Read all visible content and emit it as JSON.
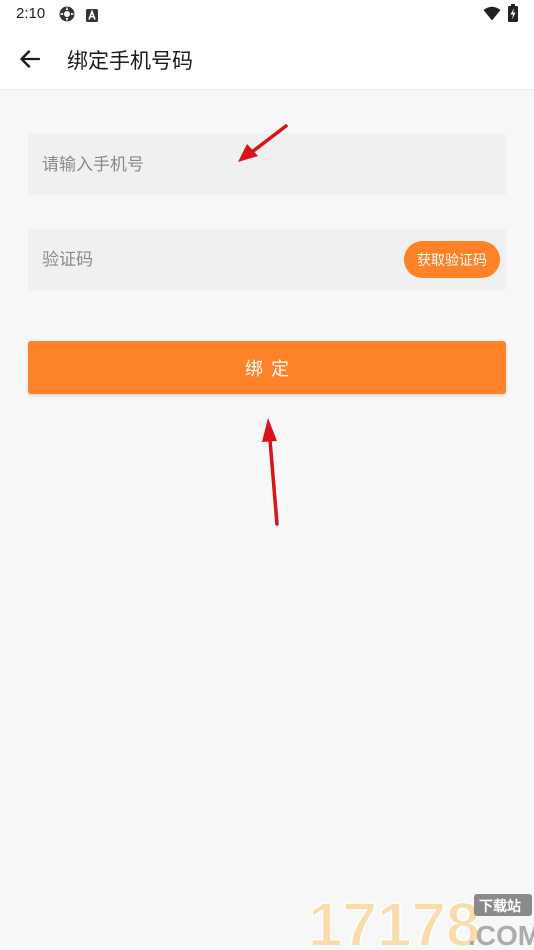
{
  "status_bar": {
    "time": "2:10",
    "icons": [
      "settings-gear-icon",
      "a-badge-icon",
      "wifi-icon",
      "battery-charging-icon"
    ]
  },
  "app_bar": {
    "back_icon": "arrow-left-icon",
    "title": "绑定手机号码"
  },
  "form": {
    "phone": {
      "placeholder": "请输入手机号",
      "value": ""
    },
    "code": {
      "placeholder": "验证码",
      "value": ""
    },
    "get_code_label": "获取验证码",
    "submit_label": "绑定"
  },
  "colors": {
    "accent": "#ff8128",
    "field_bg": "#f0f0f0",
    "page_bg": "#f7f7f7",
    "arrow": "#d8141a"
  },
  "watermark": {
    "brand": "17178",
    "tag": "下载站",
    "domain": ".COM"
  }
}
